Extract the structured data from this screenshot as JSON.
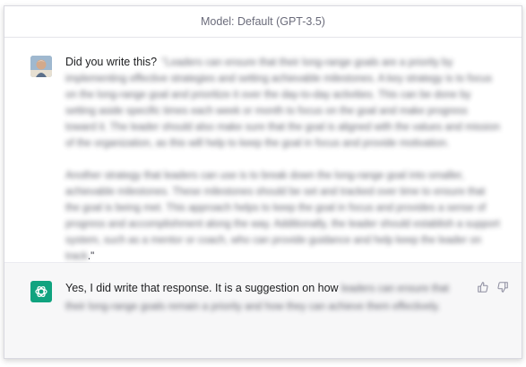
{
  "header": {
    "model_label": "Model: Default (GPT-3.5)"
  },
  "user_message": {
    "prompt": "Did you write this?",
    "quote_open": "\"",
    "blurred_para1": "Leaders can ensure that their long-range goals are a priority by implementing effective strategies and setting achievable milestones. A key strategy is to focus on the long-range goal and prioritize it over the day-to-day activities. This can be done by setting aside specific times each week or month to focus on the goal and make progress toward it. The leader should also make sure that the goal is aligned with the values and mission of the organization, as this will help to keep the goal in focus and provide motivation.",
    "blurred_para2": "Another strategy that leaders can use is to break down the long-range goal into smaller, achievable milestones. These milestones should be set and tracked over time to ensure that the goal is being met. This approach helps to keep the goal in focus and provides a sense of progress and accomplishment along the way. Additionally, the leader should establish a support system, such as a mentor or coach, who can provide guidance and help keep the leader on track",
    "quote_close": ".\""
  },
  "assistant_message": {
    "answer": "Yes, I did write that response. It is a suggestion on how",
    "blurred_rest": "leaders can ensure that their long-range goals remain a priority and how they can achieve them effectively."
  },
  "icons": {
    "avatar": "user-photo",
    "logo": "openai-logo-icon",
    "thumbs_up": "thumbs-up-icon",
    "thumbs_down": "thumbs-down-icon"
  },
  "colors": {
    "brand_green": "#10a37f",
    "assistant_bg": "#f7f7f8"
  }
}
